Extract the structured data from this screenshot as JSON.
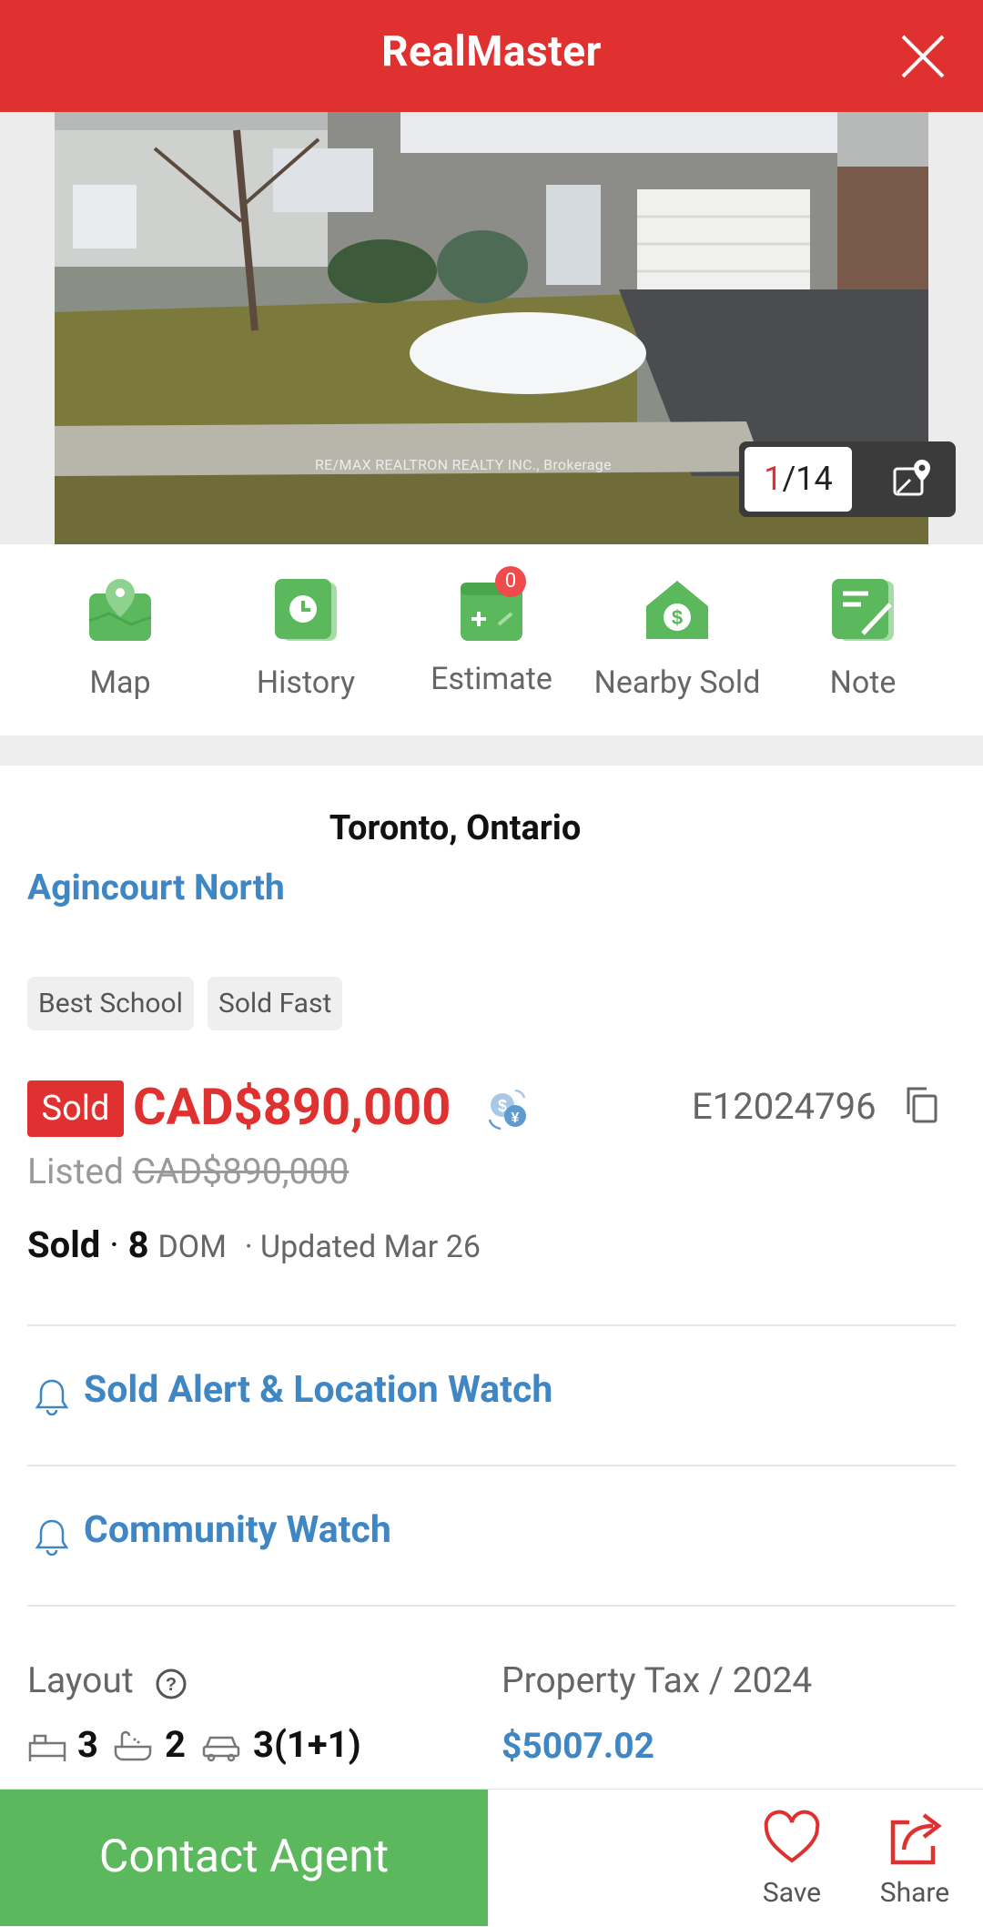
{
  "header": {
    "title": "RealMaster"
  },
  "photo": {
    "watermark": "RE/MAX REALTRON REALTY INC., Brokerage",
    "counter_current": "1",
    "counter_total": "/14"
  },
  "actions": [
    {
      "label": "Map"
    },
    {
      "label": "History"
    },
    {
      "label": "Estimate",
      "badge": "0"
    },
    {
      "label": "Nearby Sold"
    },
    {
      "label": "Note"
    }
  ],
  "listing": {
    "location": "Toronto, Ontario",
    "community": "Agincourt North",
    "tags": [
      "Best School",
      "Sold Fast"
    ],
    "status_badge": "Sold",
    "price": "CAD$890,000",
    "mls_id": "E12024796",
    "listed_label": "Listed",
    "listed_price": "CAD$890,000",
    "status_word": "Sold",
    "dom_value": "8",
    "dom_label": "DOM",
    "updated": "· Updated Mar 26"
  },
  "watches": {
    "sold_alert": "Sold Alert & Location Watch",
    "community": "Community Watch"
  },
  "details": {
    "layout_label": "Layout",
    "beds": "3",
    "baths": "2",
    "parking": "3(1+1)",
    "tax_label": "Property Tax / 2024",
    "tax_value": "$5007.02"
  },
  "bottom": {
    "contact": "Contact Agent",
    "save": "Save",
    "share": "Share"
  },
  "colors": {
    "brand": "#e03131",
    "link": "#3f87c4",
    "green": "#5cb85c"
  }
}
